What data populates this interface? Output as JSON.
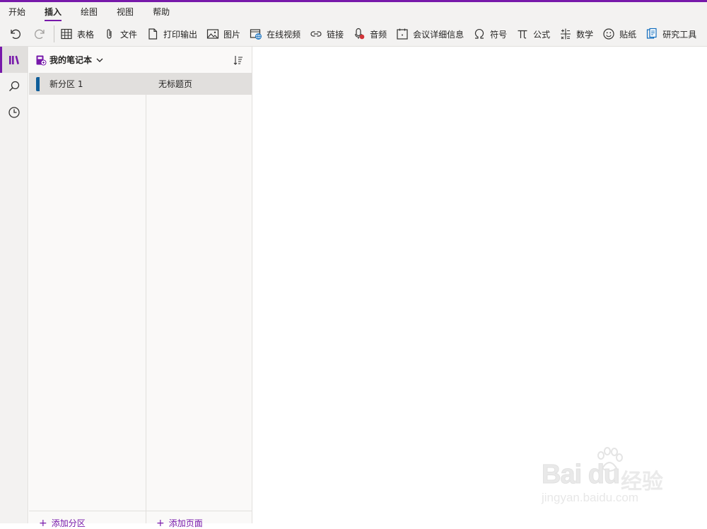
{
  "colors": {
    "accent": "#7719aa",
    "section": "#0f5d99",
    "ribbon_bg": "#f3f2f1"
  },
  "menu": {
    "tabs": [
      {
        "label": "开始"
      },
      {
        "label": "插入",
        "active": true
      },
      {
        "label": "绘图"
      },
      {
        "label": "视图"
      },
      {
        "label": "帮助"
      }
    ]
  },
  "toolbar": {
    "undo_icon": "undo-icon",
    "redo_icon": "redo-icon",
    "items": [
      {
        "label": "表格",
        "icon": "table-icon"
      },
      {
        "label": "文件",
        "icon": "paperclip-icon"
      },
      {
        "label": "打印输出",
        "icon": "document-icon"
      },
      {
        "label": "图片",
        "icon": "picture-icon"
      },
      {
        "label": "在线视频",
        "icon": "online-video-icon"
      },
      {
        "label": "链接",
        "icon": "link-icon"
      },
      {
        "label": "音频",
        "icon": "audio-record-icon"
      },
      {
        "label": "会议详细信息",
        "icon": "calendar-icon"
      },
      {
        "label": "符号",
        "icon": "omega-icon"
      },
      {
        "label": "公式",
        "icon": "pi-icon"
      },
      {
        "label": "数学",
        "icon": "math-icon"
      },
      {
        "label": "贴纸",
        "icon": "smiley-icon"
      },
      {
        "label": "研究工具",
        "icon": "research-icon"
      }
    ]
  },
  "rail": {
    "items": [
      {
        "icon": "notebooks-icon",
        "active": true
      },
      {
        "icon": "search-icon"
      },
      {
        "icon": "recent-clock-icon"
      }
    ]
  },
  "notebook": {
    "title": "我的笔记本",
    "icon": "notebook-icon",
    "dropdown_icon": "chevron-down-icon",
    "sort_icon": "sort-icon"
  },
  "sections": [
    {
      "label": "新分区 1",
      "selected": true
    }
  ],
  "pages": [
    {
      "label": "无标题页",
      "selected": true
    }
  ],
  "footer": {
    "add_section": "添加分区",
    "add_page": "添加页面"
  },
  "watermark": {
    "brand": "Bai du",
    "cn": "经验",
    "url": "jingyan.baidu.com"
  }
}
